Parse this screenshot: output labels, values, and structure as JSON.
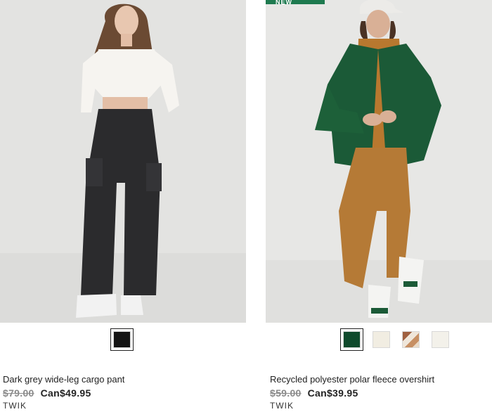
{
  "products": [
    {
      "name": "Dark grey wide-leg cargo pant",
      "old_price": "$79.00",
      "new_price": "Can$49.95",
      "brand": "TWIK",
      "swatches": [
        {
          "color": "#141414",
          "selected": true
        }
      ]
    },
    {
      "badge": "NEW",
      "name": "Recycled polyester polar fleece overshirt",
      "old_price": "$59.00",
      "new_price": "Can$39.95",
      "brand": "TWIK",
      "swatches": [
        {
          "color": "#0f4a2c",
          "selected": true
        },
        {
          "color": "#f1ede2",
          "selected": false
        },
        {
          "color": "#b9805c",
          "selected": false
        },
        {
          "color": "#f3f1ea",
          "selected": false
        }
      ]
    }
  ]
}
